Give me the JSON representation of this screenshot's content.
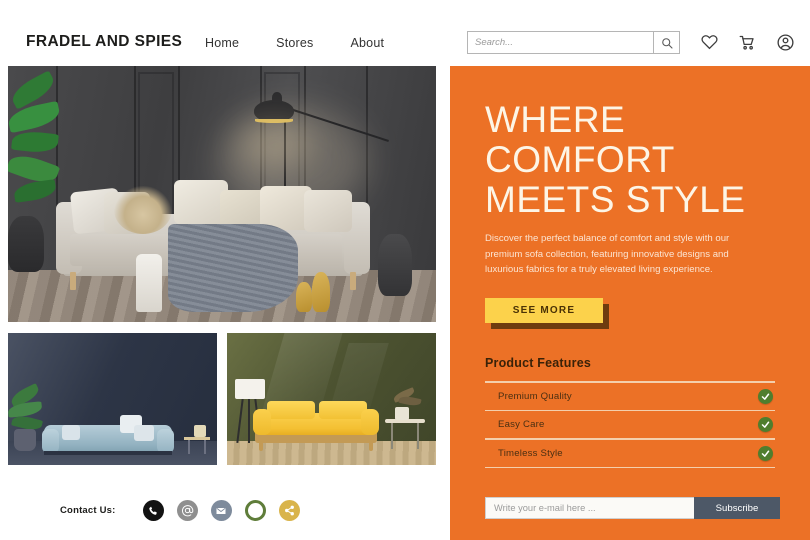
{
  "header": {
    "brand": "FRADEL AND SPIES",
    "nav": [
      {
        "label": "Home"
      },
      {
        "label": "Stores"
      },
      {
        "label": "About"
      }
    ],
    "search": {
      "placeholder": "Search...",
      "value": "",
      "button_icon": "search-icon"
    },
    "icons": [
      {
        "name": "heart-icon",
        "label": "Wishlist"
      },
      {
        "name": "cart-icon",
        "label": "Cart"
      },
      {
        "name": "user-icon",
        "label": "Account"
      }
    ]
  },
  "gallery": {
    "hero": {
      "alt": "Modern living room with light gray sofa against dark charcoal paneled wall, arc floor lamp, knit blanket and gold vases"
    },
    "thumbs": [
      {
        "alt": "Light blue sofa against dark navy blue wall with potted plant"
      },
      {
        "alt": "Yellow sofa with wooden frame against olive green wall with white floor lamp"
      }
    ]
  },
  "contact": {
    "label": "Contact Us:",
    "icons": [
      {
        "name": "phone-icon",
        "glyph": "☎",
        "color": "#121212"
      },
      {
        "name": "at-sign-icon",
        "glyph": "@",
        "color": "#8f8f8f"
      },
      {
        "name": "email-icon",
        "glyph": "✉",
        "color": "#7e8b9c"
      },
      {
        "name": "whatsapp-icon",
        "glyph": "",
        "color": "#5f7d3a"
      },
      {
        "name": "share-icon",
        "glyph": "",
        "color": "#dcb martial"
      }
    ]
  },
  "panel": {
    "background_color": "#ec7126",
    "headline": "WHERE COMFORT MEETS STYLE",
    "subtext": "Discover the perfect balance of comfort and style with our premium sofa collection, featuring innovative designs and luxurious fabrics for a truly elevated living experience.",
    "cta": {
      "label": "SEE MORE",
      "color": "#fcd24b"
    },
    "features": {
      "title": "Product Features",
      "items": [
        {
          "label": "Premium Quality",
          "checked": true
        },
        {
          "label": "Easy Care",
          "checked": true
        },
        {
          "label": "Timeless Style",
          "checked": true
        }
      ],
      "check_color": "#4f7e2e"
    },
    "newsletter": {
      "placeholder": "Write your e-mail here ...",
      "value": "",
      "button_label": "Subscribe",
      "button_color": "#4d5867"
    }
  }
}
